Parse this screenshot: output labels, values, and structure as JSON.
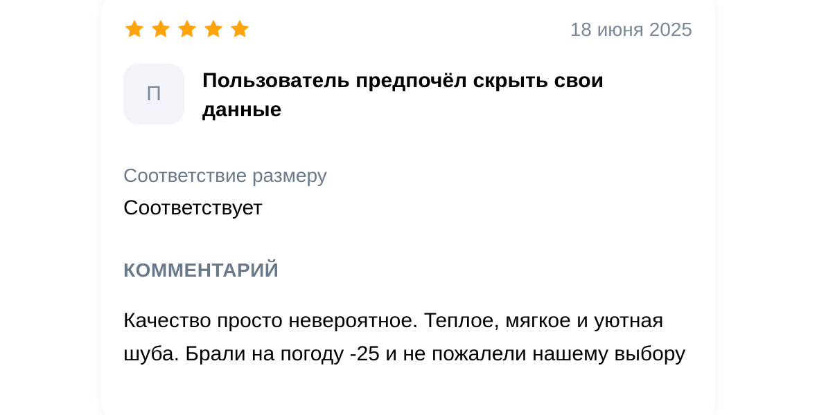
{
  "review": {
    "rating": 5,
    "rating_max": 5,
    "star_icon": "star-icon",
    "star_color": "#FFA30A",
    "date": "18 июня 2025",
    "avatar_initial": "П",
    "username": "Пользователь предпочёл скрыть свои данные",
    "size_fit_label": "Соответствие размеру",
    "size_fit_value": "Соответствует",
    "comment_title": "КОММЕНТАРИЙ",
    "comment_text": "Качество просто невероятное. Теплое, мягкое и уютная шуба. Брали на погоду -25 и не пожалели нашему выбору"
  }
}
